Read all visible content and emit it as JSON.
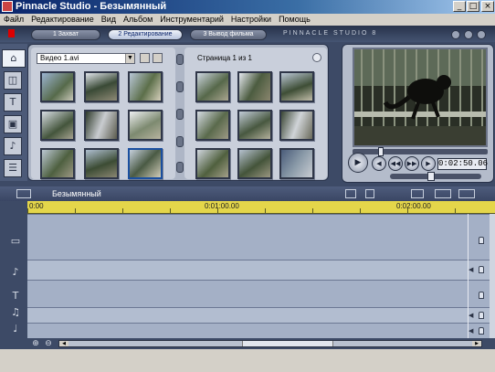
{
  "window": {
    "title": "Pinnacle Studio - Безымянный",
    "buttons": {
      "minimize": "_",
      "maximize": "□",
      "close": "×"
    }
  },
  "menu": [
    "Файл",
    "Редактирование",
    "Вид",
    "Альбом",
    "Инструментарий",
    "Настройки",
    "Помощь"
  ],
  "mode_tabs": [
    {
      "label": "1 Захват",
      "active": false
    },
    {
      "label": "2 Редактирование",
      "active": true
    },
    {
      "label": "3 Вывод фильма",
      "active": false
    }
  ],
  "brand": "PINNACLE STUDIO 8",
  "album": {
    "source_select": "Видео 1.avi",
    "page_label": "Страница 1 из 1"
  },
  "player": {
    "timecode": "0:02:50.06",
    "scrub_fraction": 0.2,
    "jog_fraction": 0.45
  },
  "timeline": {
    "project_name": "Безымянный",
    "ruler_labels": [
      "0:00",
      "0:01:00.00",
      "0:02:00.00"
    ]
  },
  "colors": {
    "ruler": "#e4d64a",
    "track_bg": "#a4b0c6",
    "active_tab": "#f0f4fa"
  },
  "icons": {
    "tools": [
      "video-scenes-icon",
      "transitions-icon",
      "titles-icon",
      "photos-icon",
      "sounds-icon",
      "menus-icon"
    ],
    "tracks": [
      "video-track-icon",
      "audio-track-icon",
      "title-track-icon",
      "sound-effect-track-icon",
      "music-track-icon"
    ]
  }
}
